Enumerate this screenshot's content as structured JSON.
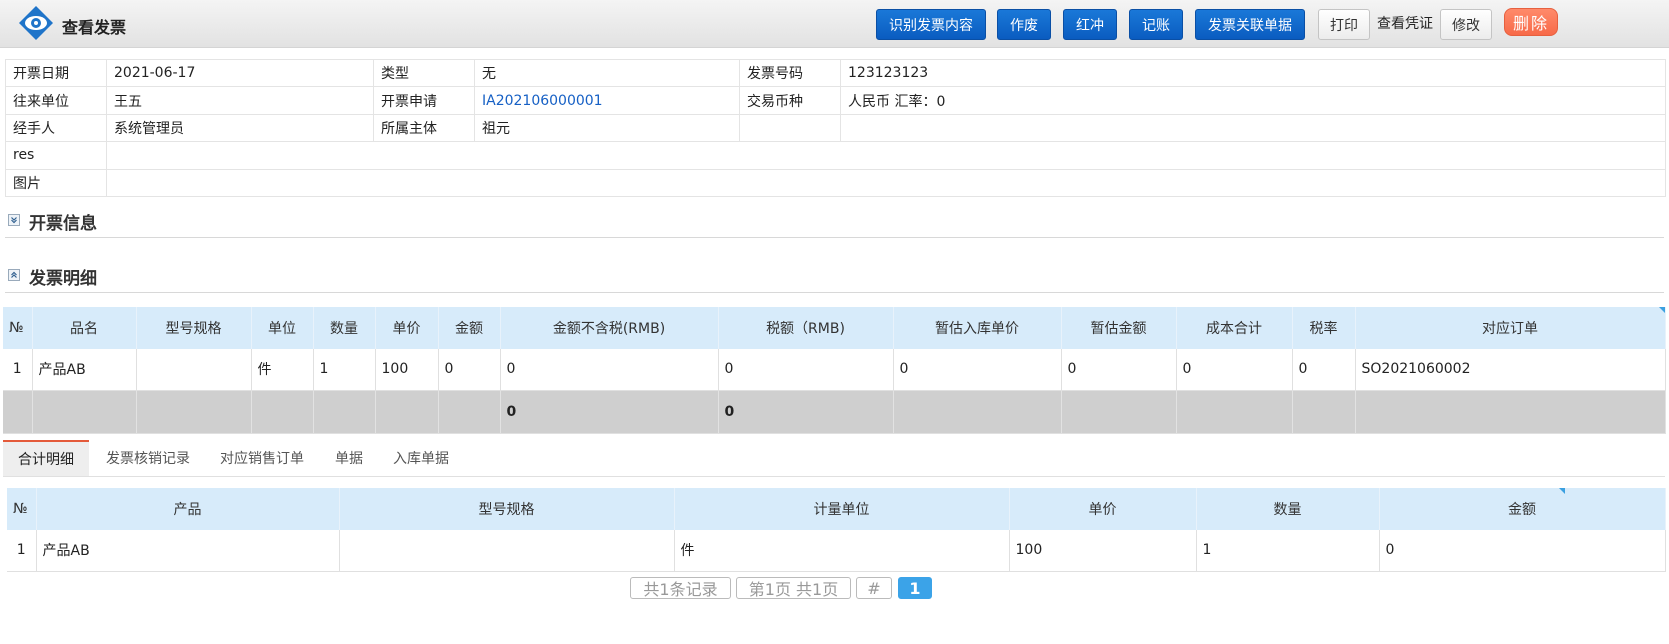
{
  "header": {
    "title": "查看发票",
    "buttons": {
      "recognize": "识别发票内容",
      "void": "作废",
      "red_reverse": "红冲",
      "post": "记账",
      "related_docs": "发票关联单据",
      "print": "打印",
      "view_voucher": "查看凭证",
      "edit": "修改",
      "delete": "删除"
    }
  },
  "info": {
    "invoice_date_label": "开票日期",
    "invoice_date": "2021-06-17",
    "type_label": "类型",
    "type": "无",
    "invoice_no_label": "发票号码",
    "invoice_no": "123123123",
    "partner_label": "往来单位",
    "partner": "王五",
    "application_label": "开票申请",
    "application": "IA202106000001",
    "currency_label": "交易币种",
    "currency": "人民币 汇率：0",
    "handler_label": "经手人",
    "handler": "系统管理员",
    "entity_label": "所属主体",
    "entity": "祖元",
    "res_label": "res",
    "image_label": "图片"
  },
  "sections": {
    "invoice_info": "开票信息",
    "invoice_detail": "发票明细"
  },
  "detail_table": {
    "headers": [
      "№",
      "品名",
      "型号规格",
      "单位",
      "数量",
      "单价",
      "金额",
      "金额不含税(RMB)",
      "税额（RMB)",
      "暂估入库单价",
      "暂估金额",
      "成本合计",
      "税率",
      "对应订单"
    ],
    "rows": [
      [
        "1",
        "产品AB",
        "",
        "件",
        "1",
        "100",
        "0",
        "0",
        "0",
        "0",
        "0",
        "0",
        "0",
        "SO2021060002"
      ]
    ],
    "summary": [
      "",
      "",
      "",
      "",
      "",
      "",
      "",
      "0",
      "0",
      "",
      "",
      "",
      "",
      ""
    ]
  },
  "tabs": [
    "合计明细",
    "发票核销记录",
    "对应销售订单",
    "单据",
    "入库单据"
  ],
  "summary_table": {
    "headers": [
      "№",
      "产品",
      "型号规格",
      "计量单位",
      "单价",
      "数量",
      "金额"
    ],
    "rows": [
      [
        "1",
        "产品AB",
        "",
        "件",
        "100",
        "1",
        "0"
      ]
    ]
  },
  "pager": {
    "total": "共1条记录",
    "page_info": "第1页 共1页",
    "hash": "#",
    "current": "1"
  },
  "colors": {
    "primary_button": "#0a5cc0",
    "delete_button": "#f76a49",
    "grid_header": "#d7ebfa",
    "summary_row": "#cfcfcf",
    "link": "#1660c5"
  }
}
